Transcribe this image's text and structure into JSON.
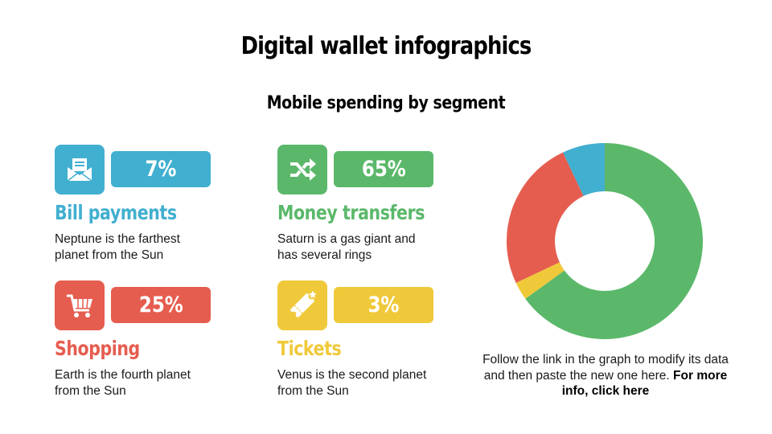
{
  "title": "Digital wallet infographics",
  "subtitle": "Mobile spending by segment",
  "colors": {
    "blue": "#41afcf",
    "green": "#5bb86a",
    "red": "#e55d4f",
    "yellow": "#f0c93a"
  },
  "items": [
    {
      "name": "Bill payments",
      "percent": "7%",
      "desc": "Neptune is the farthest planet from the Sun",
      "icon": "envelope-icon",
      "color": "blue"
    },
    {
      "name": "Money transfers",
      "percent": "65%",
      "desc": "Saturn is a gas giant and has several rings",
      "icon": "shuffle-arrows-icon",
      "color": "green"
    },
    {
      "name": "Shopping",
      "percent": "25%",
      "desc": "Earth is the fourth planet from the Sun",
      "icon": "shopping-cart-icon",
      "color": "red"
    },
    {
      "name": "Tickets",
      "percent": "3%",
      "desc": "Venus is the second planet from the Sun",
      "icon": "ticket-icon",
      "color": "yellow"
    }
  ],
  "note": {
    "text": "Follow the link in the graph to modify its data and then paste the new one here.",
    "link": "For more info, click here"
  },
  "chart_data": {
    "type": "pie",
    "donut": true,
    "categories": [
      "Money transfers",
      "Tickets",
      "Shopping",
      "Bill payments"
    ],
    "values": [
      65,
      3,
      25,
      7
    ],
    "colors": [
      "#5bb86a",
      "#f0c93a",
      "#e55d4f",
      "#41afcf"
    ],
    "start": "top",
    "direction": "clockwise"
  }
}
